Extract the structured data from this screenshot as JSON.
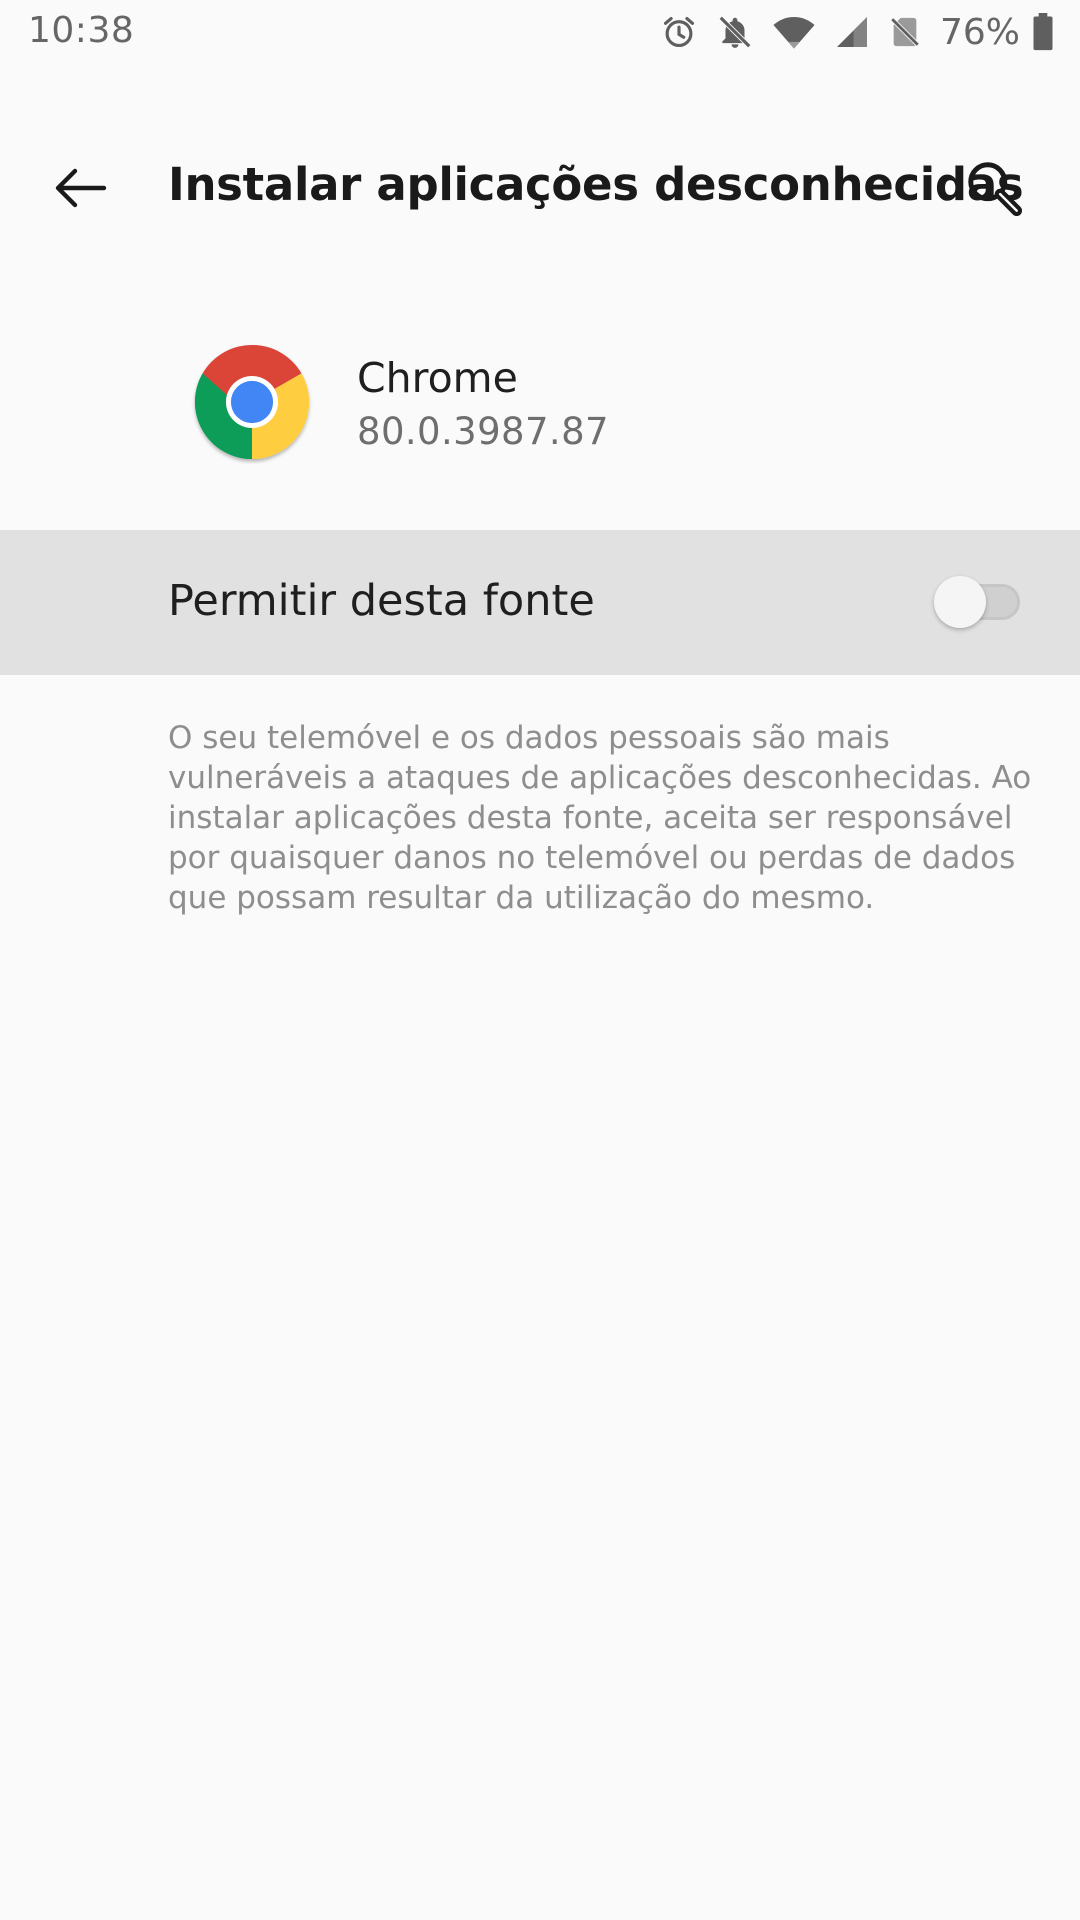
{
  "status_bar": {
    "time": "10:38",
    "battery_percent": "76%",
    "icons": [
      "alarm-icon",
      "notifications-off-icon",
      "wifi-icon",
      "cellular-signal-icon",
      "no-sim-icon",
      "battery-icon"
    ]
  },
  "toolbar": {
    "title": "Instalar aplicações desconhecidas",
    "back_icon": "arrow-back-icon",
    "search_icon": "search-icon"
  },
  "app": {
    "name": "Chrome",
    "version": "80.0.3987.87",
    "icon": "chrome-logo-icon"
  },
  "setting": {
    "label": "Permitir desta fonte",
    "enabled": false
  },
  "warning": {
    "text": "O seu telemóvel e os dados pessoais são mais vulneráveis a ataques de aplicações desconhecidas. Ao instalar aplicações desta fonte, aceita ser responsável por quaisquer danos no telemóvel ou perdas de dados que possam resultar da utilização do mesmo."
  },
  "colors": {
    "background": "#fafafa",
    "row_highlight": "#e1e1e1",
    "secondary_text": "#8e8e8e",
    "chrome_red": "#db4437",
    "chrome_green": "#0f9d58",
    "chrome_yellow": "#ffcd40",
    "chrome_blue": "#4285f4"
  }
}
